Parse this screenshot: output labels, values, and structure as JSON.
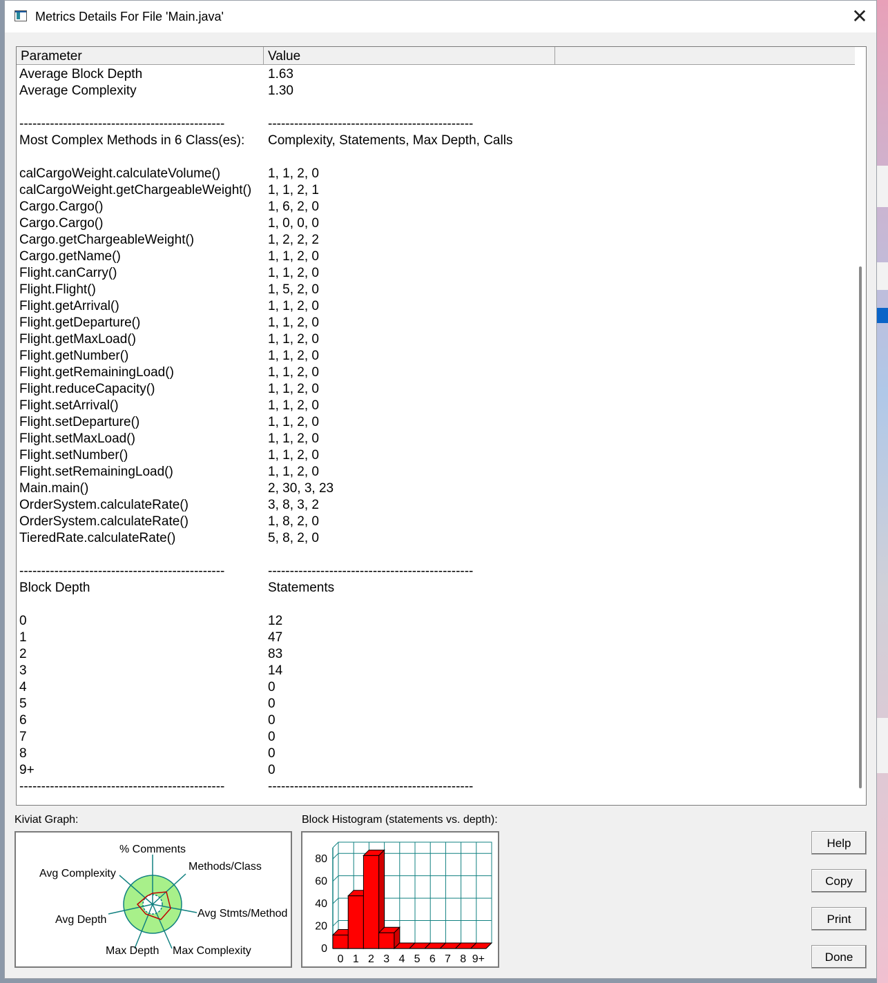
{
  "window": {
    "title": "Metrics Details For File 'Main.java'",
    "close_glyph": "✕"
  },
  "table": {
    "headers": [
      "Parameter",
      "Value"
    ],
    "rows": [
      [
        "Average Block Depth",
        "1.63"
      ],
      [
        "Average Complexity",
        "1.30"
      ],
      [
        "",
        ""
      ],
      [
        "-----------------------------------------------",
        "-----------------------------------------------"
      ],
      [
        "Most Complex Methods in 6 Class(es):",
        "Complexity, Statements, Max Depth, Calls"
      ],
      [
        "",
        ""
      ],
      [
        "calCargoWeight.calculateVolume()",
        "1, 1, 2, 0"
      ],
      [
        "calCargoWeight.getChargeableWeight()",
        "1, 1, 2, 1"
      ],
      [
        "Cargo.Cargo()",
        "1, 6, 2, 0"
      ],
      [
        "Cargo.Cargo()",
        "1, 0, 0, 0"
      ],
      [
        "Cargo.getChargeableWeight()",
        "1, 2, 2, 2"
      ],
      [
        "Cargo.getName()",
        "1, 1, 2, 0"
      ],
      [
        "Flight.canCarry()",
        "1, 1, 2, 0"
      ],
      [
        "Flight.Flight()",
        "1, 5, 2, 0"
      ],
      [
        "Flight.getArrival()",
        "1, 1, 2, 0"
      ],
      [
        "Flight.getDeparture()",
        "1, 1, 2, 0"
      ],
      [
        "Flight.getMaxLoad()",
        "1, 1, 2, 0"
      ],
      [
        "Flight.getNumber()",
        "1, 1, 2, 0"
      ],
      [
        "Flight.getRemainingLoad()",
        "1, 1, 2, 0"
      ],
      [
        "Flight.reduceCapacity()",
        "1, 1, 2, 0"
      ],
      [
        "Flight.setArrival()",
        "1, 1, 2, 0"
      ],
      [
        "Flight.setDeparture()",
        "1, 1, 2, 0"
      ],
      [
        "Flight.setMaxLoad()",
        "1, 1, 2, 0"
      ],
      [
        "Flight.setNumber()",
        "1, 1, 2, 0"
      ],
      [
        "Flight.setRemainingLoad()",
        "1, 1, 2, 0"
      ],
      [
        "Main.main()",
        "2, 30, 3, 23"
      ],
      [
        "OrderSystem.calculateRate()",
        "3, 8, 3, 2"
      ],
      [
        "OrderSystem.calculateRate()",
        "1, 8, 2, 0"
      ],
      [
        "TieredRate.calculateRate()",
        "5, 8, 2, 0"
      ],
      [
        "",
        ""
      ],
      [
        "-----------------------------------------------",
        "-----------------------------------------------"
      ],
      [
        "Block Depth",
        "Statements"
      ],
      [
        "",
        ""
      ],
      [
        "0",
        "12"
      ],
      [
        "1",
        "47"
      ],
      [
        "2",
        "83"
      ],
      [
        "3",
        "14"
      ],
      [
        "4",
        "0"
      ],
      [
        "5",
        "0"
      ],
      [
        "6",
        "0"
      ],
      [
        "7",
        "0"
      ],
      [
        "8",
        "0"
      ],
      [
        "9+",
        "0"
      ],
      [
        "-----------------------------------------------",
        "-----------------------------------------------"
      ]
    ]
  },
  "kiviat": {
    "label": "Kiviat Graph:",
    "axes": [
      "% Comments",
      "Methods/Class",
      "Avg Stmts/Method",
      "Max Complexity",
      "Max Depth",
      "Avg Depth",
      "Avg Complexity"
    ],
    "colors": {
      "ring": "#a8f08a",
      "ring_border": "#108080",
      "data_line": "#c00000"
    }
  },
  "histogram": {
    "label": "Block Histogram (statements vs. depth):",
    "colors": {
      "bar": "#ff0000",
      "grid": "#108080"
    }
  },
  "chart_data": {
    "type": "bar",
    "title": "Block Histogram (statements vs. depth):",
    "categories": [
      "0",
      "1",
      "2",
      "3",
      "4",
      "5",
      "6",
      "7",
      "8",
      "9+"
    ],
    "values": [
      12,
      47,
      83,
      14,
      0,
      0,
      0,
      0,
      0,
      0
    ],
    "yticks": [
      "0",
      "20",
      "40",
      "60",
      "80"
    ],
    "ylim": [
      0,
      90
    ],
    "grid": true
  },
  "buttons": {
    "help": "Help",
    "copy": "Copy",
    "print": "Print",
    "done": "Done"
  }
}
